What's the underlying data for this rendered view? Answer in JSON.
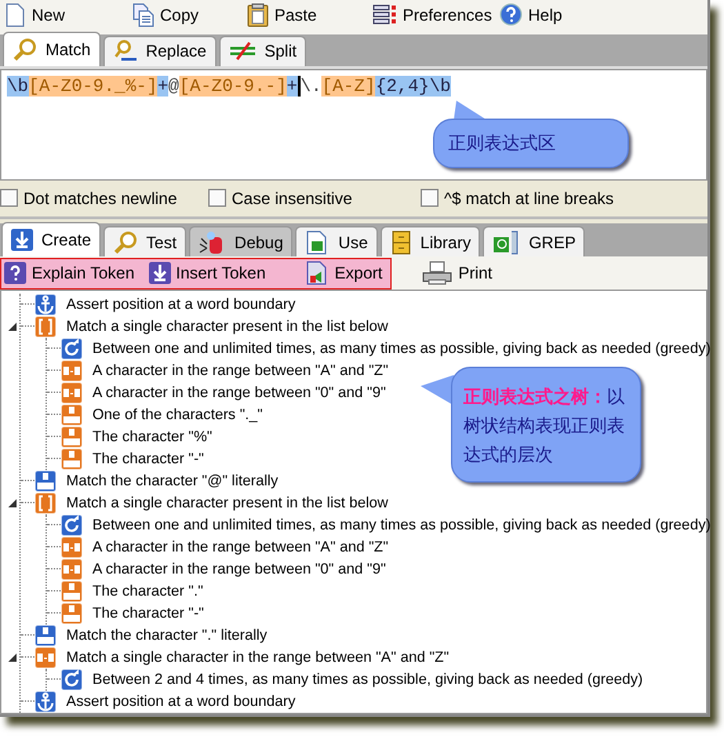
{
  "toolbar": [
    {
      "label": "New"
    },
    {
      "label": "Copy"
    },
    {
      "label": "Paste"
    },
    {
      "label": "Preferences"
    },
    {
      "label": "Help"
    }
  ],
  "mode_tabs": [
    {
      "label": "Match",
      "selected": true
    },
    {
      "label": "Replace",
      "selected": false
    },
    {
      "label": "Split",
      "selected": false
    }
  ],
  "regex": [
    {
      "text": "\\b",
      "kind": "anchor"
    },
    {
      "text": "[A-Z0-9._%-]",
      "kind": "class"
    },
    {
      "text": "+",
      "kind": "quant"
    },
    {
      "text": "@",
      "kind": "plain"
    },
    {
      "text": "[A-Z0-9.-]",
      "kind": "class"
    },
    {
      "text": "+",
      "kind": "quant",
      "cursor": true
    },
    {
      "text": "\\.",
      "kind": "plain"
    },
    {
      "text": "[A-Z]",
      "kind": "class"
    },
    {
      "text": "{2,4}\\b",
      "kind": "quant"
    }
  ],
  "options": [
    {
      "label": "Dot matches newline",
      "checked": false
    },
    {
      "label": "Case insensitive",
      "checked": false
    },
    {
      "label": "^$ match at line breaks",
      "checked": false
    }
  ],
  "panel_tabs": [
    {
      "label": "Create",
      "selected": true
    },
    {
      "label": "Test",
      "selected": false
    },
    {
      "label": "Debug",
      "selected": false
    },
    {
      "label": "Use",
      "selected": false
    },
    {
      "label": "Library",
      "selected": false
    },
    {
      "label": "GREP",
      "selected": false
    }
  ],
  "actions": [
    {
      "label": "Explain Token",
      "highlighted": true
    },
    {
      "label": "Insert Token",
      "highlighted": true
    },
    {
      "label": "Export",
      "highlighted": true
    },
    {
      "label": "Print",
      "highlighted": false
    }
  ],
  "tree": [
    {
      "text": "Assert position at a word boundary",
      "kind": "anchor"
    },
    {
      "text": "Match a single character present in the list below",
      "kind": "set",
      "expanded": true,
      "children": [
        {
          "text": "Between one and unlimited times, as many times as possible, giving back as needed (greedy)",
          "kind": "repeat"
        },
        {
          "text": "A character in the range between \"A\" and \"Z\"",
          "kind": "range"
        },
        {
          "text": "A character in the range between \"0\" and \"9\"",
          "kind": "range"
        },
        {
          "text": "One of the characters \"._\"",
          "kind": "char"
        },
        {
          "text": "The character \"%\"",
          "kind": "char"
        },
        {
          "text": "The character \"-\"",
          "kind": "char"
        }
      ]
    },
    {
      "text": "Match the character \"@\" literally",
      "kind": "literal"
    },
    {
      "text": "Match a single character present in the list below",
      "kind": "set",
      "expanded": true,
      "children": [
        {
          "text": "Between one and unlimited times, as many times as possible, giving back as needed (greedy)",
          "kind": "repeat"
        },
        {
          "text": "A character in the range between \"A\" and \"Z\"",
          "kind": "range"
        },
        {
          "text": "A character in the range between \"0\" and \"9\"",
          "kind": "range"
        },
        {
          "text": "The character \".\"",
          "kind": "char"
        },
        {
          "text": "The character \"-\"",
          "kind": "char"
        }
      ]
    },
    {
      "text": "Match the character \".\" literally",
      "kind": "literal"
    },
    {
      "text": "Match a single character in the range between \"A\" and \"Z\"",
      "kind": "range",
      "expanded": true,
      "children": [
        {
          "text": "Between 2 and 4 times, as many times as possible, giving back as needed (greedy)",
          "kind": "repeat"
        }
      ]
    },
    {
      "text": "Assert position at a word boundary",
      "kind": "anchor"
    }
  ],
  "callouts": [
    {
      "text": "正则表达式区"
    },
    {
      "text": "**正则表达式之树：**以树状结构表现正则表达式的层次"
    }
  ]
}
